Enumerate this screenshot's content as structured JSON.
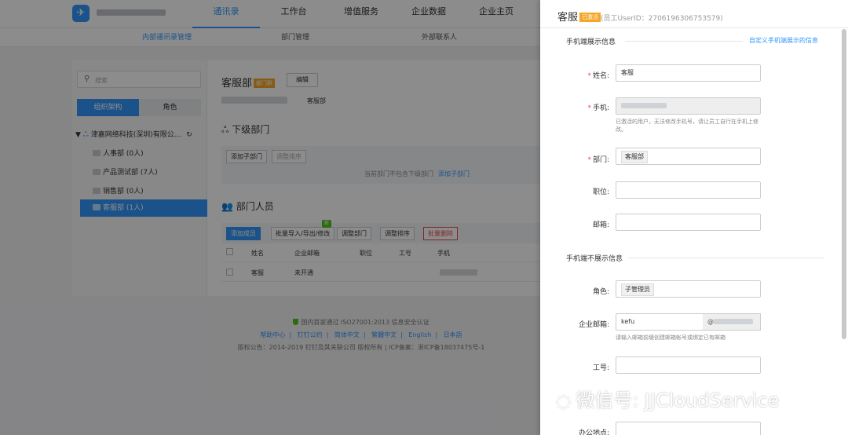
{
  "top_nav": {
    "items": [
      "通讯录",
      "工作台",
      "增值服务",
      "企业数据",
      "企业主页"
    ],
    "active_index": 0
  },
  "sub_nav": {
    "items": [
      "内部通讯录管理",
      "部门管理",
      "外部联系人"
    ],
    "active_index": 0
  },
  "sidebar": {
    "search_placeholder": "搜索",
    "tab_org": "组织架构",
    "tab_role": "角色",
    "root_org": "津嘉网络科技(深圳)有限公...",
    "departments": [
      "人事部 (0人)",
      "产品测试部 (7人)",
      "销售部 (0人)",
      "客服部 (1人)"
    ],
    "selected_index": 3
  },
  "dept_panel": {
    "name": "客服部",
    "tag": "部门群",
    "edit_label": "编辑",
    "crumb": "客服部",
    "sub_title": "下级部门",
    "add_sub_label": "添加子部门",
    "reorder_label": "调整排序",
    "empty_note": "当前部门不包含下级部门",
    "empty_link": "添加子部门",
    "members_title": "部门人员",
    "btn_add_member": "添加成员",
    "btn_import": "批量导入/导出/修改",
    "new_badge": "新",
    "btn_adjust_dept": "调整部门",
    "btn_reorder": "调整排序",
    "btn_batch_delete": "批量删除",
    "columns": [
      "姓名",
      "企业邮箱",
      "职位",
      "工号",
      "手机"
    ],
    "rows": [
      {
        "name": "客服",
        "email": "未开通",
        "title": "",
        "job_no": ""
      }
    ]
  },
  "footer": {
    "cert": "国内首家通过 ISO27001:2013 信息安全认证",
    "links": [
      "帮助中心",
      "钉钉公约",
      "简体中文",
      "繁體中文",
      "English",
      "日本語"
    ],
    "copyright": "版权公告：2014-2019 钉钉及其关联公司 版权所有 | ICP备案：浙ICP备18037475号-1"
  },
  "drawer": {
    "title": "客服",
    "tag": "已激活",
    "userid": "(员工UserID：2706196306753579)",
    "section_shown": "手机端展示信息",
    "section_link": "自定义手机端展示的信息",
    "section_hidden": "手机端不展示信息",
    "fields": {
      "name_label": "姓名:",
      "name_value": "客服",
      "phone_label": "手机:",
      "phone_hint": "已激活的用户，无法修改手机号，请让员工自行在手机上修改。",
      "dept_label": "部门:",
      "dept_value": "客服部",
      "position_label": "职位:",
      "position_value": "",
      "email_label": "邮箱:",
      "email_value": "",
      "role_label": "角色:",
      "role_value": "子管理员",
      "corp_mail_label": "企业邮箱:",
      "corp_mail_user": "kefu",
      "corp_mail_at": "@",
      "corp_mail_hint": "请输入邮箱前缀创建邮箱帐号或绑定已有邮箱",
      "job_no_label": "工号:",
      "job_no_value": "",
      "office_label": "办公地点:",
      "office_value": ""
    }
  },
  "watermark": {
    "text": "微信号: JJCloudService"
  },
  "colors": {
    "accent": "#3296fa",
    "tag": "#f5a623",
    "danger": "#e84a4a",
    "success": "#52c41a"
  }
}
